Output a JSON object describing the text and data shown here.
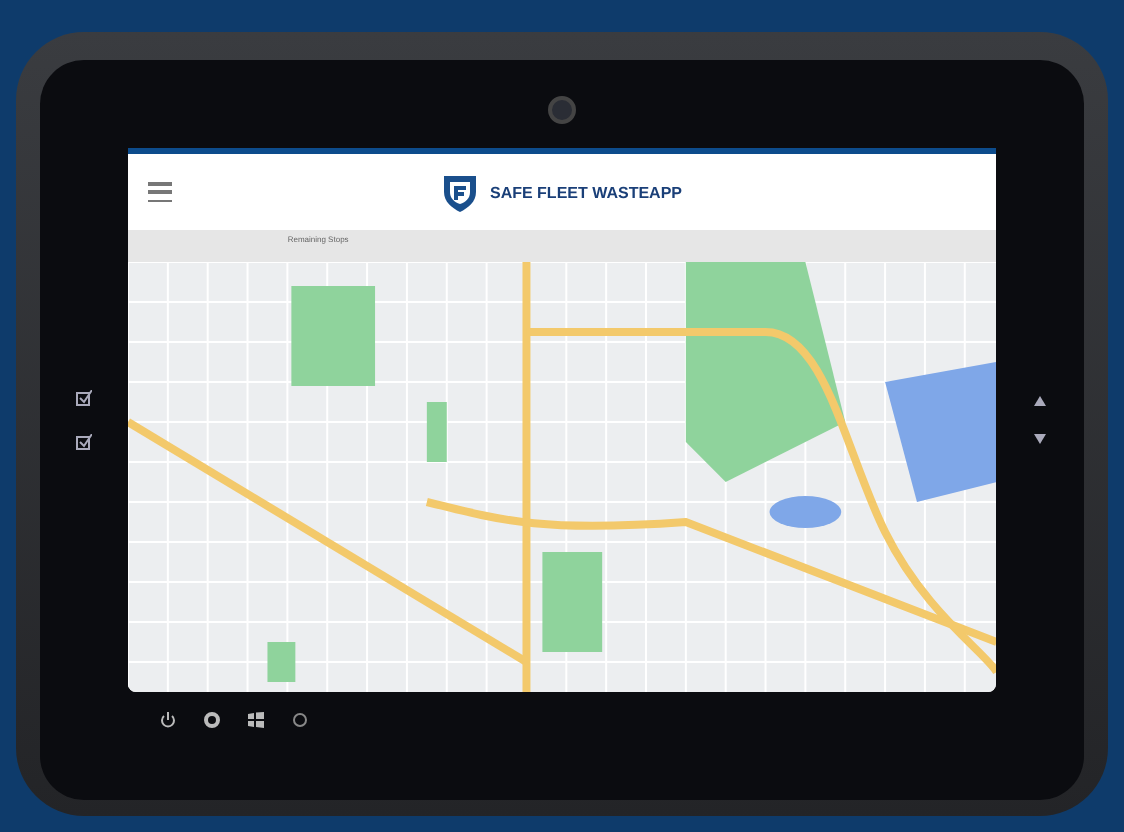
{
  "app": {
    "title": "SAFE FLEET WASTEAPP"
  },
  "info_bar": {
    "remaining_label": "Remaining Stops"
  }
}
